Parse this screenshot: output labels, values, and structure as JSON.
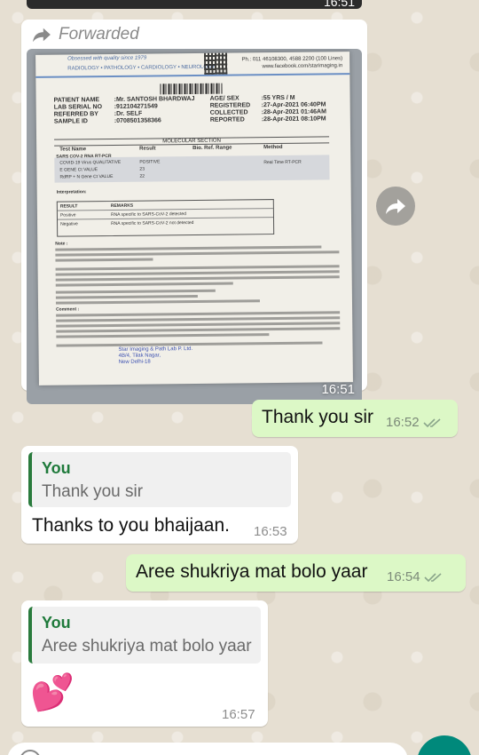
{
  "top_message": {
    "time": "16:51"
  },
  "forwarded_message": {
    "label": "Forwarded",
    "time": "16:51",
    "report": {
      "tagline": "Obsessed with quality since 1979",
      "departments": "RADIOLOGY • PATHOLOGY • CARDIOLOGY • NEUROLOGY",
      "phone": "Ph.: 011 46108300, 4588 2200 (100 Lines)",
      "website": "www.facebook.com/starimaging.in",
      "patient_name_label": "PATIENT NAME",
      "patient_name": ":Mr. SANTOSH BHARDWAJ",
      "lab_serial_label": "LAB SERIAL NO",
      "lab_serial": ":912104271549",
      "referred_by_label": "REFERRED BY",
      "referred_by": ":Dr. SELF",
      "sample_id_label": "SAMPLE ID",
      "sample_id": ":0708501358366",
      "age_sex_label": "AGE/ SEX",
      "age_sex": ":55 YRS / M",
      "registered_label": "REGISTERED",
      "registered": ":27-Apr-2021 06:40PM",
      "collected_label": "COLLECTED",
      "collected": ":28-Apr-2021 01:46AM",
      "reported_label": "REPORTED",
      "reported": ":28-Apr-2021 08:10PM",
      "section": "MOLECULAR SECTION",
      "col_test": "Test Name",
      "col_result": "Result",
      "col_range": "Bio. Ref. Range",
      "col_method": "Method",
      "test_title": "SARS COV-2 RNA RT-PCR",
      "test_1": "COVID-19 Virus QUALITATIVE",
      "result_1": "POSITIVE",
      "method_1": "Real Time RT-PCR",
      "test_2": "E GENE Ct VALUE",
      "result_2": "23",
      "test_3": "RdRP + N Gene Ct VALUE",
      "result_3": "22",
      "interpretation": "Interpretation:",
      "table_col_result": "RESULT",
      "table_col_remarks": "REMARKS",
      "table_row_1_result": "Positive",
      "table_row_1_remark": "RNA specific to SARS-CoV-2 detected",
      "table_row_2_result": "Negative",
      "table_row_2_remark": "RNA specific to SARS-CoV-2 not detected",
      "note": "Note :",
      "comment": "Comment :",
      "stamp_line_1": "Star Imaging & Path Lab P. Ltd.",
      "stamp_line_2": "4B/4, Tilak Nagar,",
      "stamp_line_3": "New Delhi-18"
    }
  },
  "messages": [
    {
      "direction": "out",
      "text": "Thank you sir",
      "time": "16:52",
      "read": true
    },
    {
      "direction": "in",
      "quote_author": "You",
      "quote_text": "Thank you sir",
      "text": "Thanks to you bhaijaan.",
      "time": "16:53"
    },
    {
      "direction": "out",
      "text": "Aree shukriya mat bolo yaar",
      "time": "16:54",
      "read": true
    },
    {
      "direction": "in",
      "quote_author": "You",
      "quote_text": "Aree shukriya mat bolo yaar",
      "emoji": "💕",
      "time": "16:57"
    }
  ],
  "colors": {
    "outgoing_bubble": "#dcf8c6",
    "incoming_bubble": "#ffffff",
    "read_ticks": "#4fc3f7",
    "quote_accent": "#1f7a3b",
    "fab": "#00897b"
  },
  "icons": {
    "forward": "forward-arrow-icon",
    "share": "share-icon",
    "ticks": "double-check-icon",
    "emoji": "emoji-icon",
    "mic": "mic-icon"
  }
}
